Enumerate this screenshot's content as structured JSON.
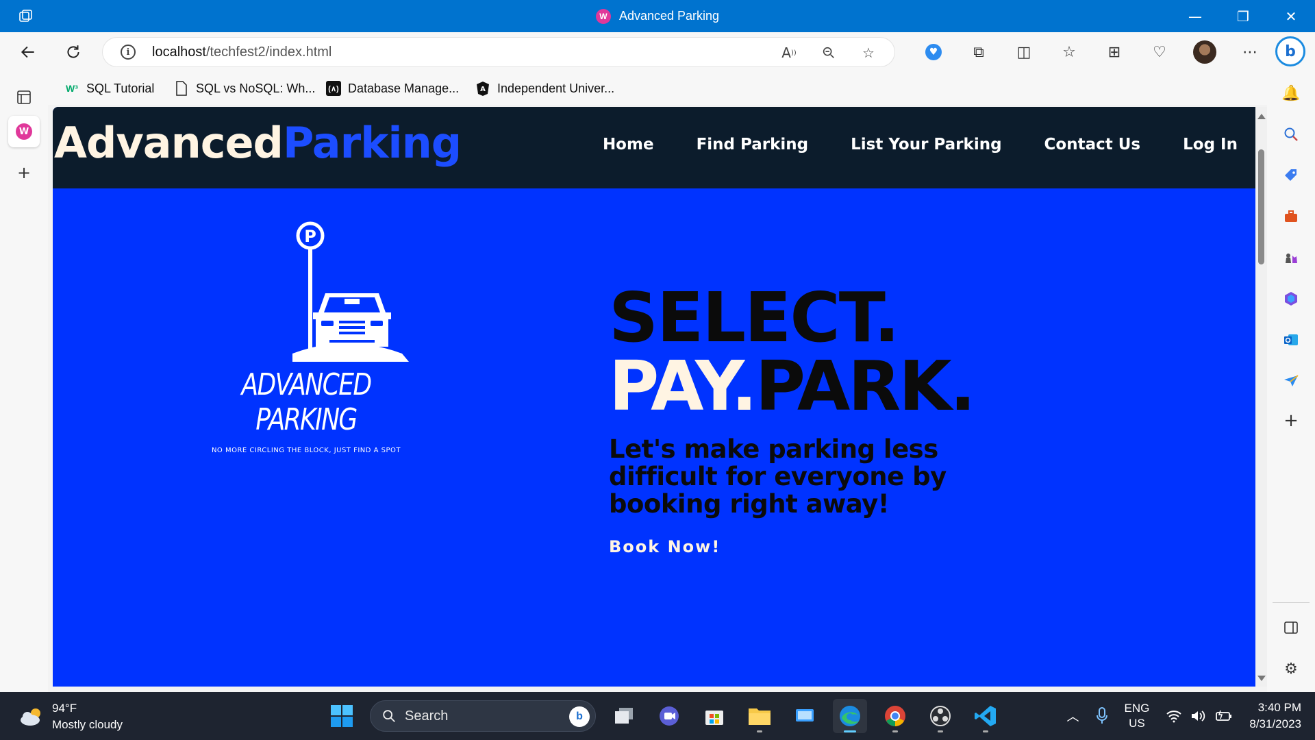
{
  "window": {
    "title": "Advanced Parking",
    "controls": {
      "minimize": "—",
      "restore": "❐",
      "close": "✕"
    }
  },
  "toolbar": {
    "url_host": "localhost",
    "url_path": "/techfest2/index.html"
  },
  "bookmarks": [
    {
      "label": "SQL Tutorial",
      "icon": "w3schools-icon"
    },
    {
      "label": "SQL vs NoSQL: Wh...",
      "icon": "document-icon"
    },
    {
      "label": "Database Manage...",
      "icon": "database-site-icon"
    },
    {
      "label": "Independent Univer...",
      "icon": "university-icon"
    }
  ],
  "site": {
    "brand_part1": "Advanced",
    "brand_part2": "Parking",
    "nav": [
      "Home",
      "Find Parking",
      "List Your Parking",
      "Contact Us",
      "Log In"
    ],
    "logo_title": "ADVANCED PARKING",
    "logo_tagline": "NO MORE CIRCLING THE BLOCK, JUST FIND A SPOT",
    "logo_sign": "P",
    "hero_line1": "SELECT.",
    "hero_pay": "PAY.",
    "hero_park": "PARK.",
    "hero_subhead": "Let's make parking less difficult for everyone by booking right away!",
    "cta": "Book Now!",
    "colors": {
      "nav_bg": "#0c1c2c",
      "hero_bg": "#0033ff",
      "accent_blue": "#1c4dff",
      "cream": "#fff4e3"
    }
  },
  "taskbar": {
    "weather_temp": "94°F",
    "weather_desc": "Mostly cloudy",
    "search_placeholder": "Search",
    "lang_line1": "ENG",
    "lang_line2": "US",
    "time": "3:40 PM",
    "date": "8/31/2023"
  }
}
